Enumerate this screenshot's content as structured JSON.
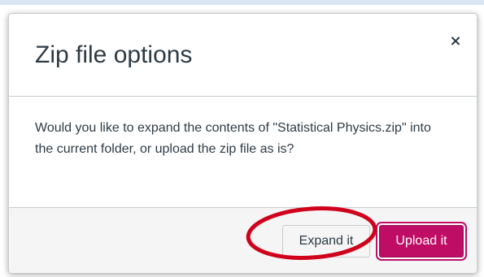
{
  "dialog": {
    "title": "Zip file options",
    "close_label": "×",
    "body_text": "Would you like to expand the contents of \"Statistical Physics.zip\" into the current folder, or upload the zip file as is?",
    "expand_label": "Expand it",
    "upload_label": "Upload it",
    "accent_color": "#bf0d66",
    "annotation_color": "#d0021b"
  }
}
